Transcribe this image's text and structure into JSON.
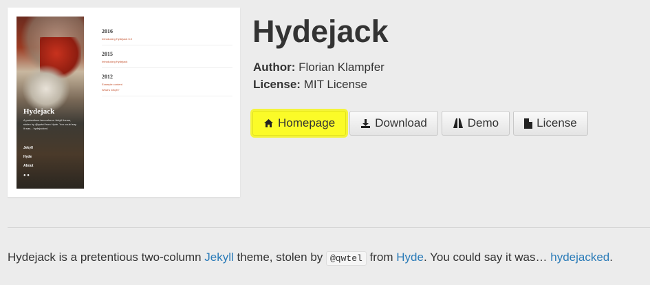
{
  "thumbnail": {
    "sidebar": {
      "title": "Hydejack",
      "description": "A pretentious two-column Jekyll theme, stolen by @qwtel from Hyde. You could say it was... hydejacked.",
      "nav": [
        "Jekyll",
        "Hyde",
        "About"
      ]
    },
    "archive": [
      {
        "year": "2016",
        "links": [
          "Introducing Hydejack 6.0"
        ]
      },
      {
        "year": "2015",
        "links": [
          "Introducing Hydejack"
        ]
      },
      {
        "year": "2012",
        "links": [
          "Example content",
          "What's Jekyll?"
        ]
      }
    ]
  },
  "theme": {
    "title": "Hydejack",
    "author_label": "Author:",
    "author": "Florian Klampfer",
    "license_label": "License:",
    "license": "MIT License"
  },
  "buttons": {
    "homepage": "Homepage",
    "download": "Download",
    "demo": "Demo",
    "license": "License"
  },
  "description": {
    "part1": "Hydejack is a pretentious two-column ",
    "link_jekyll": "Jekyll",
    "part2": " theme, stolen by ",
    "code": "@qwtel",
    "part3": " from ",
    "link_hyde": "Hyde",
    "part4": ". You could say it was… ",
    "link_hydejacked": "hydejacked",
    "part5": "."
  },
  "colors": {
    "highlight": "#fbfb28",
    "link": "#2a7bb8"
  }
}
